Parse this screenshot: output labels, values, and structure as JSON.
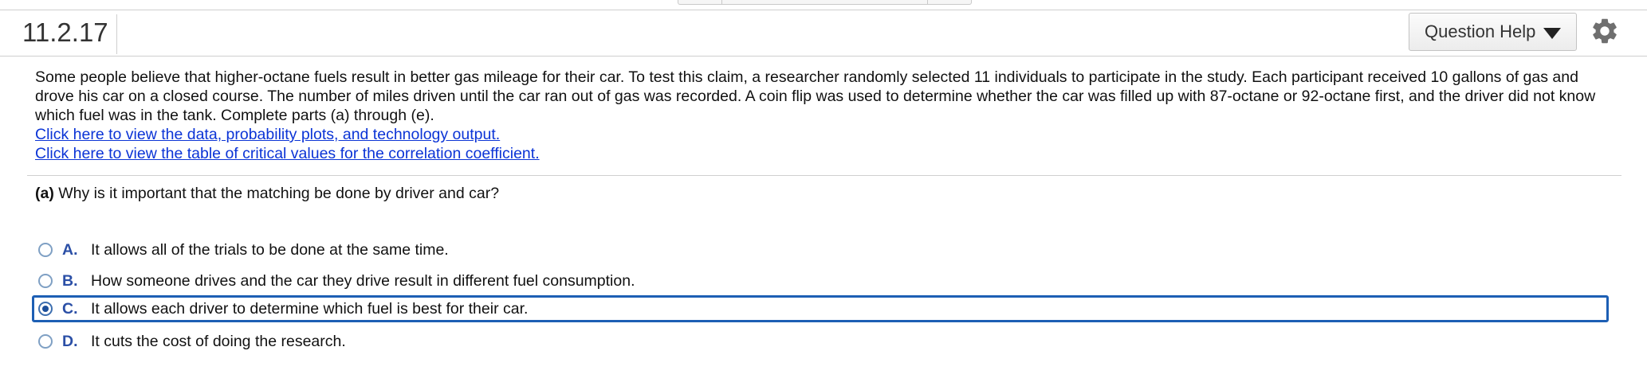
{
  "header": {
    "problem_number": "11.2.17",
    "help_button_label": "Question Help"
  },
  "intro": {
    "text": "Some people believe that higher-octane fuels result in better gas mileage for their car. To test this claim, a researcher randomly selected 11 individuals to participate in the study. Each participant received 10 gallons of gas and drove his car on a closed course. The number of miles driven until the car ran out of gas was recorded. A coin flip was used to determine whether the car was filled up with 87-octane or 92-octane first, and the driver did not know which fuel was in the tank. Complete parts (a) through (e).",
    "link_data": "Click here to view the data, probability plots, and technology output.",
    "link_table": "Click here to view the table of critical values for the correlation coefficient."
  },
  "question": {
    "part_label": "(a)",
    "text": "Why is it important that the matching be done by driver and car?"
  },
  "options": [
    {
      "letter": "A.",
      "text": "It allows all of the trials to be done at the same time.",
      "selected": false
    },
    {
      "letter": "B.",
      "text": "How someone drives and the car they drive result in different fuel consumption.",
      "selected": false
    },
    {
      "letter": "C.",
      "text": "It allows each driver to determine which fuel is best for their car.",
      "selected": true
    },
    {
      "letter": "D.",
      "text": "It cuts the cost of doing the research.",
      "selected": false
    }
  ],
  "colors": {
    "link": "#0b34d6",
    "option_letter": "#2b4fa6",
    "selection_border": "#1d5fb4",
    "rule": "#cfcfcf"
  }
}
